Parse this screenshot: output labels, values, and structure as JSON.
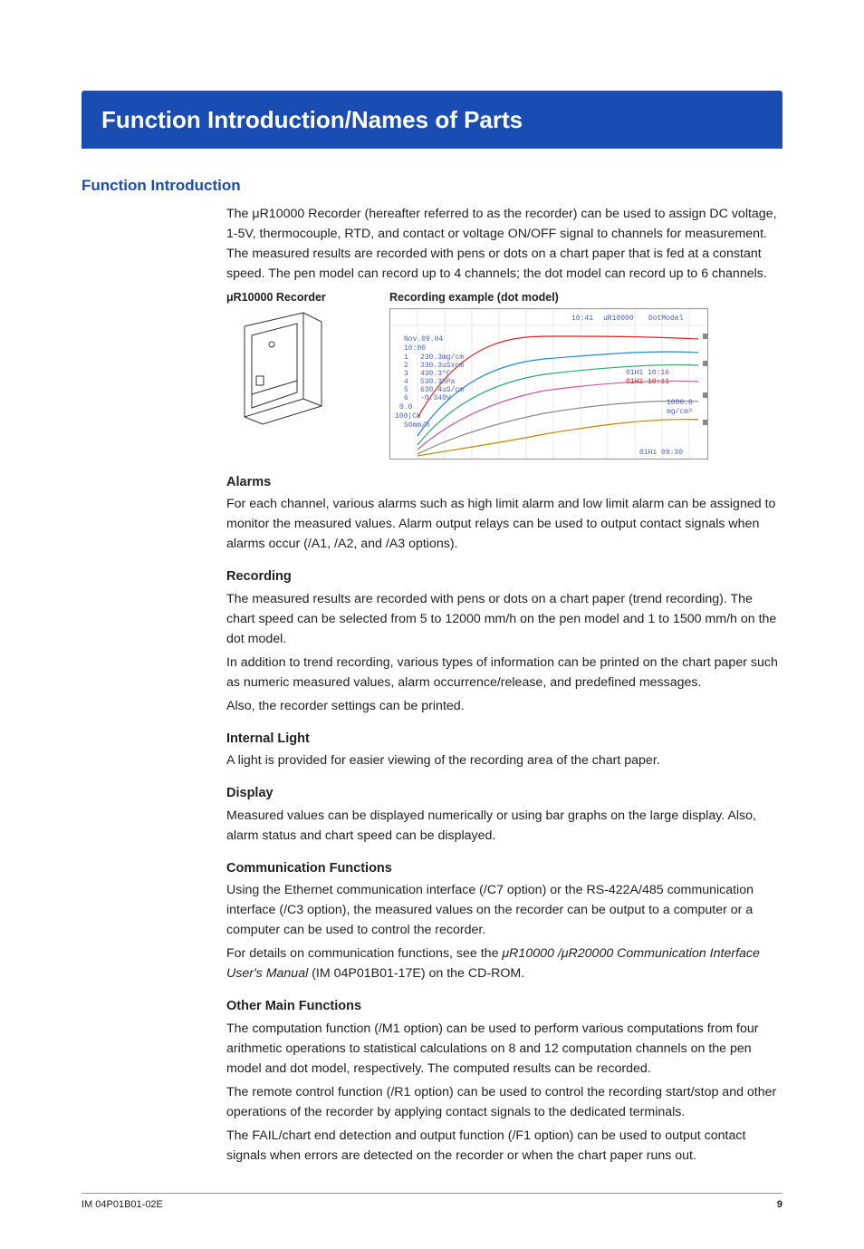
{
  "banner": "Function Introduction/Names of Parts",
  "section_title": "Function Introduction",
  "intro_para": "The μR10000 Recorder (hereafter referred to as the recorder) can be used to assign DC voltage, 1-5V, thermocouple, RTD, and contact or voltage ON/OFF signal to channels for measurement. The measured results are recorded with pens or dots on a chart paper that is fed at a constant speed. The pen model can record up to 4 channels; the dot model can record up to 6 channels.",
  "fig_labels": {
    "device": "μR10000 Recorder",
    "chart": "Recording example (dot model)"
  },
  "chart_text": {
    "header_time": "10:41",
    "header_model": "uR10000",
    "header_mode": "DotModel",
    "date": "Nov.09.04",
    "time": "10:00",
    "ch1": "230.3mg/cm",
    "ch2": "330.3uSxcm",
    "ch3": "430.3°C",
    "ch4": "530.3hPa",
    "ch5": "630.4uS/cm",
    "ch6": "-0.340V",
    "zero": "0.0",
    "left_ch": "100|CH",
    "speed": "50mm/h",
    "right_val": "1000.0",
    "right_unit": "mg/cm³",
    "ann1": "01H1 10:16",
    "ann2": "01H1 10:11",
    "ann3": "01H1 09:30"
  },
  "sections": {
    "alarms": {
      "title": "Alarms",
      "body": "For each channel, various alarms such as high limit alarm and low limit alarm can be assigned to monitor the measured values. Alarm output relays can be used to output contact signals when alarms occur (/A1, /A2, and /A3 options)."
    },
    "recording": {
      "title": "Recording",
      "p1": "The measured results are recorded with pens or dots on a chart paper (trend recording). The chart speed can be selected from 5 to 12000 mm/h on the pen model and 1 to 1500 mm/h on the dot model.",
      "p2": "In addition to trend recording, various types of information can be printed on the chart paper such as numeric measured values, alarm occurrence/release, and predefined messages.",
      "p3": "Also, the recorder settings can be printed."
    },
    "light": {
      "title": "Internal Light",
      "body": "A light is provided for easier viewing of the recording area of the chart paper."
    },
    "display": {
      "title": "Display",
      "body": "Measured values can be displayed numerically or using bar graphs on the large display. Also, alarm status and chart speed can be displayed."
    },
    "comm": {
      "title": "Communication Functions",
      "p1": "Using the Ethernet communication interface (/C7 option) or the RS-422A/485 communication interface (/C3 option), the measured values on the recorder can be output to a computer or a computer can be used to control the recorder.",
      "p2_prefix": "For details on communication functions, see the ",
      "p2_em": "μR10000 /μR20000 Communication Interface User's Manual",
      "p2_suffix": " (IM 04P01B01-17E) on the CD-ROM."
    },
    "other": {
      "title": "Other Main Functions",
      "p1": "The computation function (/M1 option) can be used to perform various computations from four arithmetic operations to statistical calculations on 8 and 12 computation channels on the pen model and dot model, respectively. The computed results can be recorded.",
      "p2": "The remote control function (/R1 option) can be used to control the recording start/stop and other operations of the recorder by applying contact signals to the dedicated terminals.",
      "p3": "The FAIL/chart end detection and output function (/F1 option) can be used to output contact signals when errors are detected on the recorder or when the chart paper runs out."
    }
  },
  "footer": {
    "doc_id": "IM 04P01B01-02E",
    "page": "9"
  }
}
